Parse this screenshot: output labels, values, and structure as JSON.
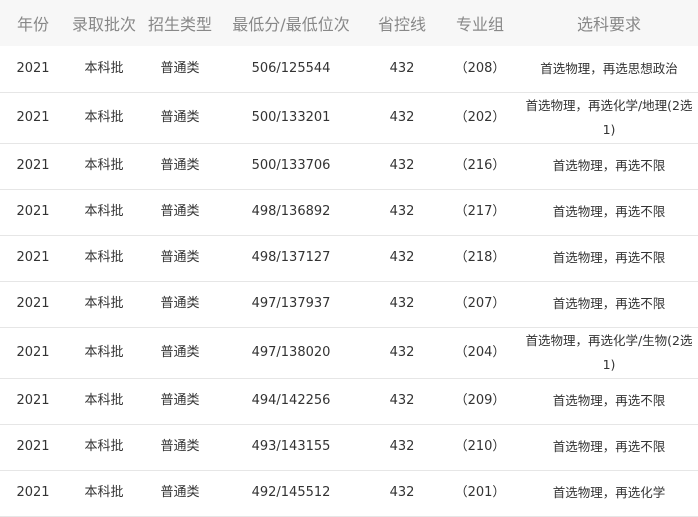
{
  "table": {
    "headers": [
      "年份",
      "录取批次",
      "招生类型",
      "最低分/最低位次",
      "省控线",
      "专业组",
      "选科要求"
    ],
    "rows": [
      [
        "2021",
        "本科批",
        "普通类",
        "506/125544",
        "432",
        "（208）",
        "首选物理，再选思想政治"
      ],
      [
        "2021",
        "本科批",
        "普通类",
        "500/133201",
        "432",
        "（202）",
        "首选物理，再选化学/地理(2选1)"
      ],
      [
        "2021",
        "本科批",
        "普通类",
        "500/133706",
        "432",
        "（216）",
        "首选物理，再选不限"
      ],
      [
        "2021",
        "本科批",
        "普通类",
        "498/136892",
        "432",
        "（217）",
        "首选物理，再选不限"
      ],
      [
        "2021",
        "本科批",
        "普通类",
        "498/137127",
        "432",
        "（218）",
        "首选物理，再选不限"
      ],
      [
        "2021",
        "本科批",
        "普通类",
        "497/137937",
        "432",
        "（207）",
        "首选物理，再选不限"
      ],
      [
        "2021",
        "本科批",
        "普通类",
        "497/138020",
        "432",
        "（204）",
        "首选物理，再选化学/生物(2选1)"
      ],
      [
        "2021",
        "本科批",
        "普通类",
        "494/142256",
        "432",
        "（209）",
        "首选物理，再选不限"
      ],
      [
        "2021",
        "本科批",
        "普通类",
        "493/143155",
        "432",
        "（210）",
        "首选物理，再选不限"
      ],
      [
        "2021",
        "本科批",
        "普通类",
        "492/145512",
        "432",
        "（201）",
        "首选物理，再选化学"
      ]
    ]
  }
}
